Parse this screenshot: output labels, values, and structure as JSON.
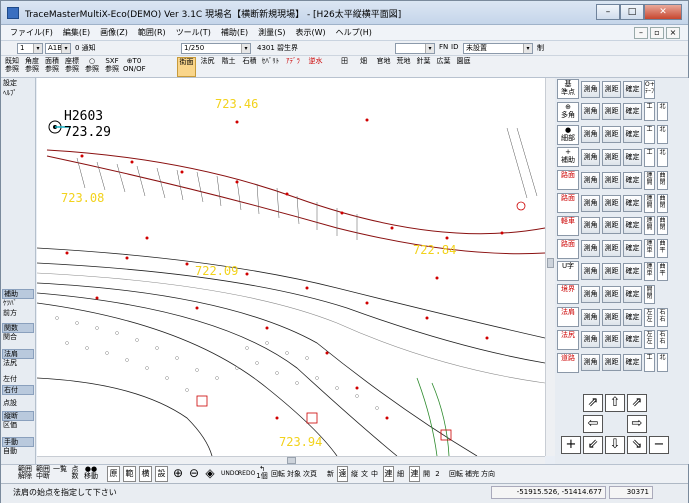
{
  "window": {
    "title": "TraceMasterMultiX-Eco(DEMO) Ver 3.1C  現場名【横断新規現場】 - [H26太平縦横平面図]",
    "btn_min": "–",
    "btn_max": "□",
    "btn_close": "✕"
  },
  "menu": [
    "ファイル(F)",
    "編集(E)",
    "画像(Z)",
    "範囲(R)",
    "ツール(T)",
    "補助(E)",
    "測量(S)",
    "表示(W)",
    "ヘルプ(H)"
  ],
  "mdi_buttons": [
    "–",
    "▫",
    "×"
  ],
  "toolbar1": {
    "combo1": "1",
    "combo2": "A1B",
    "label_layer": "0 通知",
    "combo3": "1/250",
    "label_layer2": "4301 碧生界",
    "label_fn": "FN",
    "label_id": "ID",
    "combo_id": "未設置",
    "label_misc": "制"
  },
  "toolbar2": [
    "既知\n参照",
    "角度\n参照",
    "面積\n参照",
    "座標\n参照",
    "○\n参照",
    "SXF\n参照",
    "⊕T0\nON/OF",
    "街面",
    "法尻",
    "階土",
    "石積",
    "ｾﾊﾞﾘﾄ",
    "ｱﾃﾞﾗ",
    "逆水",
    "田",
    "畑",
    "官地",
    "荒地",
    "針葉",
    "広葉",
    "園庭"
  ],
  "left_panel": [
    "設定",
    "ﾍﾙﾌﾟ",
    "補助",
    "ｹﾂﾊﾞ",
    "前方",
    "関数",
    "関合",
    "法肩",
    "法尻",
    "左付",
    "右付",
    "点設",
    "縦断",
    "区価",
    "手動",
    "自動"
  ],
  "canvas": {
    "labels": [
      "723.46",
      "H2603",
      "723.29",
      "723.08",
      "722.84",
      "722.09",
      "723.94"
    ],
    "station": "H2603",
    "colors": {
      "line": "#8a1010",
      "elev": "#f2d21c",
      "point": "#d00000",
      "green": "#2c8a2c"
    }
  },
  "right_panel": {
    "rows": [
      {
        "icon": "基\n準点",
        "b1": "測角",
        "b2": "測距",
        "b3": "確定",
        "s1": "O+Oy\nﾃｰﾌﾞ"
      },
      {
        "icon": "⊕\n多角",
        "b1": "測角",
        "b2": "測距",
        "b3": "確定",
        "s1": "工",
        "s2": "北"
      },
      {
        "icon": "●\n細部",
        "b1": "測角",
        "b2": "測距",
        "b3": "確定",
        "s1": "工",
        "s2": "北"
      },
      {
        "icon": "+\n補助",
        "b1": "測角",
        "b2": "測距",
        "b3": "確定",
        "s1": "工",
        "s2": "北"
      },
      {
        "icon": "路面",
        "b1": "測角",
        "b2": "測距",
        "b3": "確定",
        "s1": "連\n開",
        "s2": "曲\n閉"
      },
      {
        "icon": "路面",
        "b1": "測角",
        "b2": "測距",
        "b3": "確定",
        "s1": "連\n開",
        "s2": "曲\n閉"
      },
      {
        "icon": "軽車",
        "b1": "測角",
        "b2": "測距",
        "b3": "確定",
        "s1": "連\n開",
        "s2": "曲\n閉"
      },
      {
        "icon": "路面",
        "b1": "測角",
        "b2": "測距",
        "b3": "確定",
        "s1": "連\n単",
        "s2": "曲\n平"
      },
      {
        "icon": "U字",
        "b1": "測角",
        "b2": "測距",
        "b3": "確定",
        "s1": "連\n単",
        "s2": "曲\n平"
      },
      {
        "icon": "境界",
        "b1": "測角",
        "b2": "測距",
        "b3": "確定",
        "s1": "開\n閉"
      },
      {
        "icon": "法肩",
        "b1": "測角",
        "b2": "測距",
        "b3": "確定",
        "s1": "左\n左",
        "s2": "右\n右"
      },
      {
        "icon": "法尻",
        "b1": "測角",
        "b2": "測距",
        "b3": "確定",
        "s1": "左\n左",
        "s2": "右\n右"
      },
      {
        "icon": "道路",
        "b1": "測角",
        "b2": "測距",
        "b3": "確定",
        "s1": "工",
        "s2": "北"
      }
    ],
    "arrows": [
      "⇗",
      "⇧",
      "⇗",
      "⇦",
      "⇨",
      "+",
      "⇙",
      "⇩",
      "⇘",
      "−"
    ]
  },
  "bottom_toolbar": [
    "範囲\n解除",
    "範囲\n中断",
    "一覧",
    "点\n数",
    "●●\n移動",
    "原",
    "範",
    "横",
    "設",
    "⊕",
    "⊖",
    "◈",
    "UNDO",
    "REDO",
    "↰\n1個",
    "回転",
    "対象",
    "次頁",
    "新",
    "遠",
    "縦",
    "文",
    "中",
    "連",
    "細",
    "連",
    "開",
    "2",
    "回転",
    "補完",
    "方向"
  ],
  "status": {
    "message": "法肩の始点を指定して下さい",
    "coords": "-51915.526, -51414.677",
    "scale": "30371"
  }
}
